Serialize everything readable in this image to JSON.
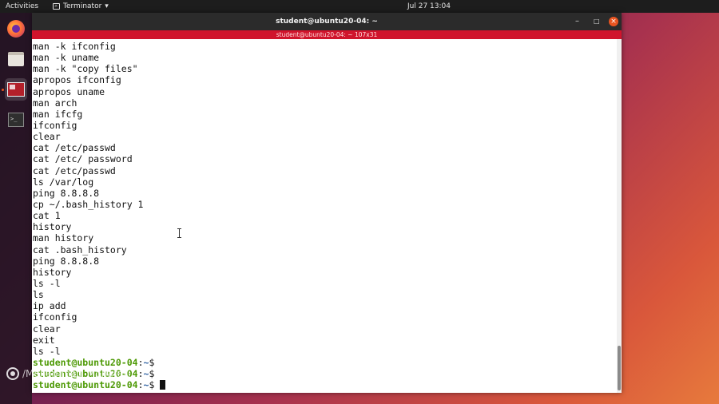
{
  "topbar": {
    "activities": "Activities",
    "app_name": "Terminator",
    "app_menu_arrow": "▾",
    "clock": "Jul 27  13:04"
  },
  "dock": {
    "apps": [
      "firefox-icon",
      "files-icon",
      "terminator-icon",
      "terminal-icon"
    ]
  },
  "window": {
    "title": "student@ubuntu20-04: ~",
    "terminal_title": "student@ubuntu20-04: ~ 107x31",
    "controls": {
      "minimize": "–",
      "maximize": "□",
      "close": "×"
    }
  },
  "terminal": {
    "output_lines": [
      "man -k ifconfig",
      "man -k uname",
      "man -k \"copy files\"",
      "apropos ifconfig",
      "apropos uname",
      "man arch",
      "man ifcfg",
      "ifconfig",
      "clear",
      "cat /etc/passwd",
      "cat /etc/ password",
      "cat /etc/passwd",
      "ls /var/log",
      "ping 8.8.8.8",
      "cp ~/.bash_history 1",
      "cat 1",
      "history",
      "man history",
      "cat .bash_history",
      "ping 8.8.8.8",
      "history",
      "ls -l",
      "ls",
      "ip add",
      "ifconfig",
      "clear",
      "exit",
      "ls -l"
    ],
    "prompts": [
      {
        "user": "student@ubuntu20-04",
        "sep": ":",
        "path": "~",
        "sym": "$"
      },
      {
        "user": "student@ubuntu20-04",
        "sep": ":",
        "path": "~",
        "sym": "$"
      },
      {
        "user": "student@ubuntu20-04",
        "sep": ":",
        "path": "~",
        "sym": "$"
      }
    ],
    "colors": {
      "prompt_user": "#4e9a06",
      "prompt_path": "#3465a4",
      "title_red": "#d0142c"
    }
  },
  "watermark": {
    "text": "/Mohammad_Moharesi"
  }
}
